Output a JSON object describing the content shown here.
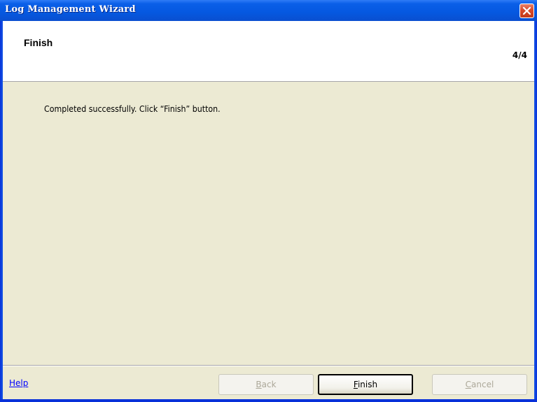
{
  "window": {
    "title": "Log Management Wizard",
    "close_icon": "close-icon"
  },
  "header": {
    "title": "Finish",
    "step": "4/4"
  },
  "content": {
    "message": "Completed successfully. Click “Finish” button."
  },
  "footer": {
    "help_label": "Help",
    "back": {
      "prefix": "",
      "accel": "B",
      "rest": "ack",
      "enabled": false
    },
    "finish": {
      "prefix": "",
      "accel": "F",
      "rest": "inish",
      "enabled": true
    },
    "cancel": {
      "prefix": "",
      "accel": "C",
      "rest": "ancel",
      "enabled": false
    }
  },
  "colors": {
    "titlebar": "#0558e0",
    "client_background": "#ecead3",
    "header_background": "#ffffff",
    "link": "#0000ff",
    "disabled_text": "#aca899"
  }
}
